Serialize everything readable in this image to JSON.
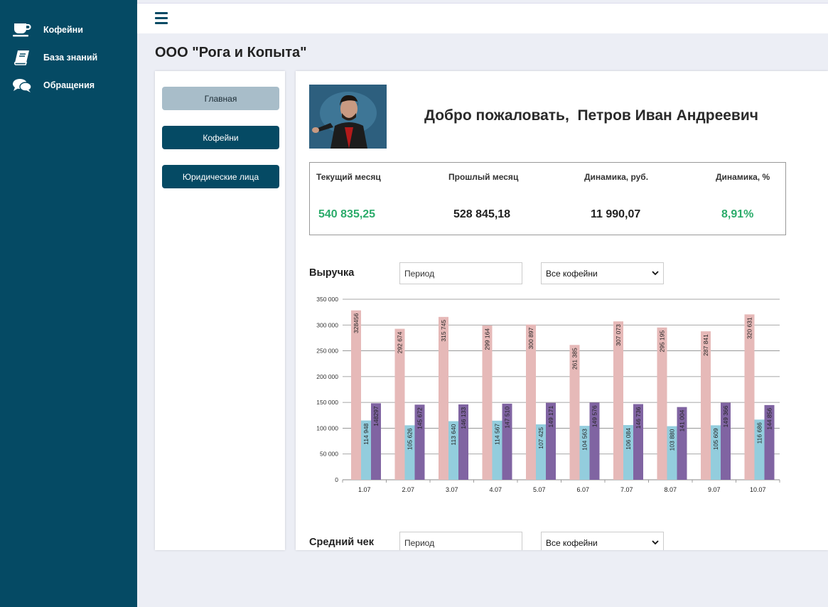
{
  "sidebar": {
    "items": [
      {
        "label": "Кофейни",
        "icon": "coffee-cup-icon"
      },
      {
        "label": "База знаний",
        "icon": "book-icon"
      },
      {
        "label": "Обращения",
        "icon": "chat-bubbles-icon"
      }
    ]
  },
  "header": {
    "menu_icon": "hamburger-menu-icon"
  },
  "company": {
    "title": "ООО \"Рога и Копыта\""
  },
  "nav": {
    "home": "Главная",
    "coffee_shops": "Кофейни",
    "legal_entities": "Юридические лица"
  },
  "welcome": {
    "text": "Добро пожаловать,  Петров Иван Андреевич",
    "avatar": "user-photo"
  },
  "stats": {
    "current_month": {
      "label": "Текущий месяц",
      "value": "540 835,25"
    },
    "previous_month": {
      "label": "Прошлый месяц",
      "value": "528 845,18"
    },
    "dynamics_rub": {
      "label": "Динамика, руб.",
      "value": "11 990,07"
    },
    "dynamics_pct": {
      "label": "Динамика, %",
      "value": "8,91%"
    }
  },
  "colors": {
    "sidebar": "#054a64",
    "positive": "#2bab6a",
    "series_pink": "#e6b9b8",
    "series_blue": "#93cddd",
    "series_purple": "#8064a2"
  },
  "revenue": {
    "title": "Выручка",
    "period_placeholder": "Период",
    "select_value": "Все кофейни"
  },
  "avg_check": {
    "title": "Средний чек",
    "period_placeholder": "Период",
    "select_value": "Все кофейни"
  },
  "chart_data": {
    "type": "bar",
    "categories": [
      "1.07",
      "2.07",
      "3.07",
      "4.07",
      "5.07",
      "6.07",
      "7.07",
      "8.07",
      "9.07",
      "10.07"
    ],
    "series": [
      {
        "color": "#e6b9b8",
        "values": [
          328456,
          292674,
          315745,
          299164,
          300897,
          261385,
          307073,
          295195,
          287841,
          320631
        ],
        "labels": [
          "328456",
          "292 674",
          "315 745",
          "299 164",
          "300 897",
          "261 385",
          "307 073",
          "295 195",
          "287 841",
          "320 631"
        ]
      },
      {
        "color": "#93cddd",
        "values": [
          114948,
          105626,
          113640,
          114567,
          107425,
          104563,
          106084,
          103880,
          105609,
          116686
        ],
        "labels": [
          "114 948",
          "105 626",
          "113 640",
          "114 567",
          "107 425",
          "104 563",
          "106 084",
          "103 880",
          "105 609",
          "116 686"
        ]
      },
      {
        "color": "#8064a2",
        "values": [
          148297,
          145672,
          146133,
          147510,
          149171,
          149576,
          146736,
          141004,
          149366,
          144856
        ],
        "labels": [
          "148297",
          "145 672",
          "146 133",
          "147 510",
          "149 171",
          "149 576",
          "146 736",
          "141 004",
          "149 366",
          "144 856"
        ]
      }
    ],
    "yticks": [
      "0",
      "50 000",
      "100 000",
      "150 000",
      "200 000",
      "250 000",
      "300 000",
      "350 000"
    ],
    "ylim": [
      0,
      350000
    ],
    "grid": true,
    "title": "",
    "xlabel": "",
    "ylabel": ""
  }
}
